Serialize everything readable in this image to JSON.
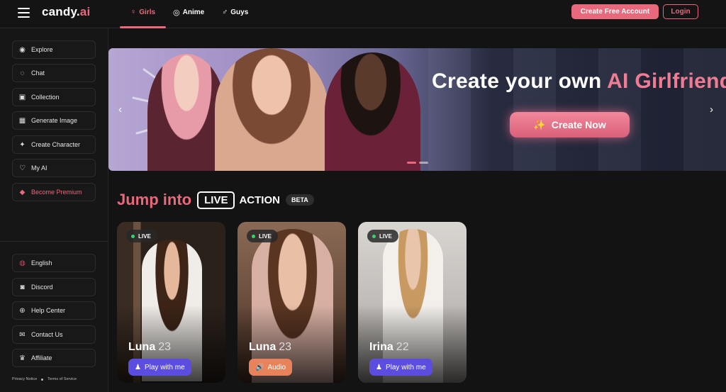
{
  "header": {
    "logo": "candy.ai",
    "logo_main": "candy.",
    "logo_ai": "ai",
    "tabs": [
      {
        "label": "Girls",
        "icon": "female-icon",
        "active": true
      },
      {
        "label": "Anime",
        "icon": "anime-icon",
        "active": false
      },
      {
        "label": "Guys",
        "icon": "male-icon",
        "active": false
      }
    ],
    "create_account": "Create Free Account",
    "login": "Login"
  },
  "sidebar": {
    "items": [
      {
        "label": "Explore",
        "icon": "compass-icon"
      },
      {
        "label": "Chat",
        "icon": "chat-icon"
      },
      {
        "label": "Collection",
        "icon": "collection-icon"
      },
      {
        "label": "Generate Image",
        "icon": "image-icon"
      },
      {
        "label": "Create Character",
        "icon": "sparkle-icon"
      },
      {
        "label": "My AI",
        "icon": "heart-icon"
      },
      {
        "label": "Become Premium",
        "icon": "diamond-icon"
      }
    ],
    "bottom_items": [
      {
        "label": "English",
        "icon": "us-flag-icon"
      },
      {
        "label": "Discord",
        "icon": "discord-icon"
      },
      {
        "label": "Help Center",
        "icon": "help-icon"
      },
      {
        "label": "Contact Us",
        "icon": "contact-icon"
      },
      {
        "label": "Affiliate",
        "icon": "trophy-icon"
      }
    ],
    "privacy": "Privacy Notice",
    "terms": "Terms of Service"
  },
  "banner": {
    "title_white": "Create your own ",
    "title_pink": "AI Girlfriend",
    "cta": "Create Now"
  },
  "live_section": {
    "jump": "Jump into",
    "live": "LIVE",
    "action": "ACTION",
    "beta": "BETA"
  },
  "cards": [
    {
      "badge": "LIVE",
      "name": "Luna",
      "age": "23",
      "button": "Play with me",
      "button_icon": "play-icon"
    },
    {
      "badge": "LIVE",
      "name": "Luna",
      "age": "23",
      "button": "Audio",
      "button_icon": "speaker-icon"
    },
    {
      "badge": "LIVE",
      "name": "Irina",
      "age": "22",
      "button": "Play with me",
      "button_icon": "play-icon"
    }
  ],
  "colors": {
    "accent": "#e8687c",
    "play_button": "#5b4de0",
    "audio_button": "#e8825a",
    "live_dot": "#37d36b"
  }
}
